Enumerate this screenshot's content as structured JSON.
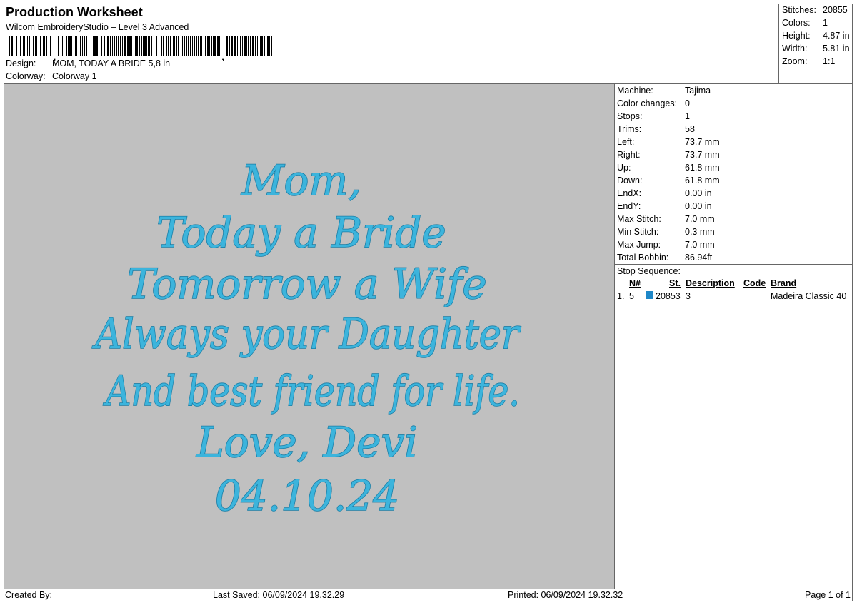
{
  "header": {
    "title": "Production Worksheet",
    "software": "Wilcom EmbroideryStudio – Level 3 Advanced",
    "design_label": "Design:",
    "design_value": "MOM, TODAY A BRIDE 5,8 in",
    "colorway_label": "Colorway:",
    "colorway_value": "Colorway 1"
  },
  "stats": {
    "stitches_label": "Stitches:",
    "stitches": "20855",
    "colors_label": "Colors:",
    "colors": "1",
    "height_label": "Height:",
    "height": "4.87 in",
    "width_label": "Width:",
    "width": "5.81 in",
    "zoom_label": "Zoom:",
    "zoom": "1:1"
  },
  "machine": [
    {
      "label": "Machine:",
      "value": "Tajima"
    },
    {
      "label": "Color changes:",
      "value": "0"
    },
    {
      "label": "Stops:",
      "value": "1"
    },
    {
      "label": "Trims:",
      "value": "58"
    },
    {
      "label": "Left:",
      "value": "73.7 mm"
    },
    {
      "label": "Right:",
      "value": "73.7 mm"
    },
    {
      "label": "Up:",
      "value": "61.8 mm"
    },
    {
      "label": "Down:",
      "value": "61.8 mm"
    },
    {
      "label": "EndX:",
      "value": "0.00 in"
    },
    {
      "label": "EndY:",
      "value": "0.00 in"
    },
    {
      "label": "Max Stitch:",
      "value": "7.0 mm"
    },
    {
      "label": "Min Stitch:",
      "value": "0.3 mm"
    },
    {
      "label": "Max Jump:",
      "value": "7.0 mm"
    },
    {
      "label": "Total Bobbin:",
      "value": "86.94ft"
    }
  ],
  "sequence": {
    "heading": "Stop Sequence:",
    "columns": {
      "n": "N#",
      "st": "St.",
      "description": "Description",
      "code": "Code",
      "brand": "Brand"
    },
    "row": {
      "index": "1.",
      "n": "5",
      "st": "20853",
      "description": "3",
      "code": "",
      "brand": "Madeira Classic 40",
      "color": "#1e87c8"
    }
  },
  "design_text": [
    "Mom,",
    "Today a Bride",
    "Tomorrow a Wife",
    "Always your Daughter",
    "And best friend for life.",
    "Love, Devi",
    "04.10.24"
  ],
  "thread_color": "#3cb4dc",
  "footer": {
    "created": "Created By:",
    "saved": "Last Saved: 06/09/2024 19.32.29",
    "printed": "Printed: 06/09/2024 19.32.32",
    "page": "Page 1 of 1"
  }
}
